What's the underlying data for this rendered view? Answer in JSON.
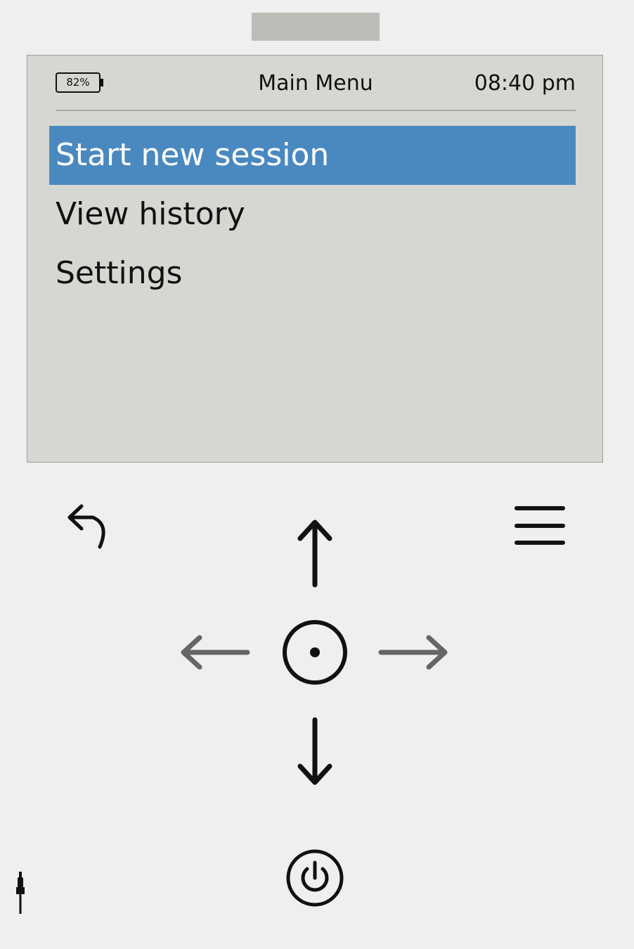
{
  "screen": {
    "battery_level": "82%",
    "title": "Main Menu",
    "time": "08:40 pm",
    "menu_items": [
      {
        "label": "Start new session",
        "selected": true
      },
      {
        "label": "View history",
        "selected": false
      },
      {
        "label": "Settings",
        "selected": false
      }
    ]
  },
  "icons": {
    "back": "back-arrow-icon",
    "menu": "hamburger-menu-icon",
    "up": "arrow-up-icon",
    "down": "arrow-down-icon",
    "left": "arrow-left-icon",
    "right": "arrow-right-icon",
    "select": "select-circle-icon",
    "power": "power-icon",
    "jack": "headphone-jack-icon"
  },
  "colors": {
    "background": "#efefef",
    "screen": "#d5d8d2",
    "selection": "#4a89c0",
    "active_icon": "#111111",
    "inactive_icon": "#666666"
  }
}
